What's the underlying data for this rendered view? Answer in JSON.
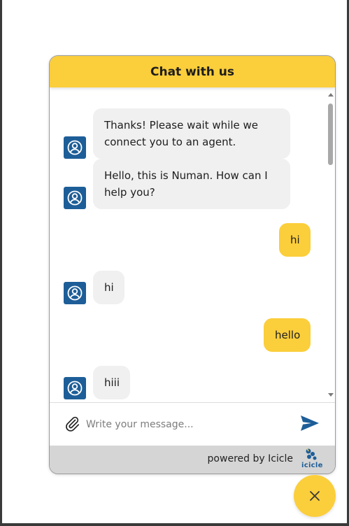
{
  "chat": {
    "title": "Chat with us",
    "messages": [
      {
        "sender": "agent",
        "text": "Thanks! Please wait while we connect you to an agent."
      },
      {
        "sender": "agent",
        "text": "Hello, this is Numan. How can I help you?"
      },
      {
        "sender": "user",
        "text": "hi"
      },
      {
        "sender": "agent",
        "text": "hi"
      },
      {
        "sender": "user",
        "text": "hello"
      },
      {
        "sender": "agent",
        "text": "hiii"
      }
    ],
    "input": {
      "placeholder": "Write your message..."
    },
    "footer": {
      "powered_by": "powered by Icicle",
      "logo_text": "icicle"
    }
  },
  "icons": {
    "avatar": "user-circle-icon",
    "attach": "paperclip-icon",
    "send": "send-icon",
    "close": "close-icon"
  },
  "colors": {
    "accent": "#fbce3b",
    "avatar_bg": "#1d5e98",
    "agent_bubble": "#f0f0f0",
    "send_icon": "#1d5e98",
    "footer_bg": "#d5d5d5"
  }
}
